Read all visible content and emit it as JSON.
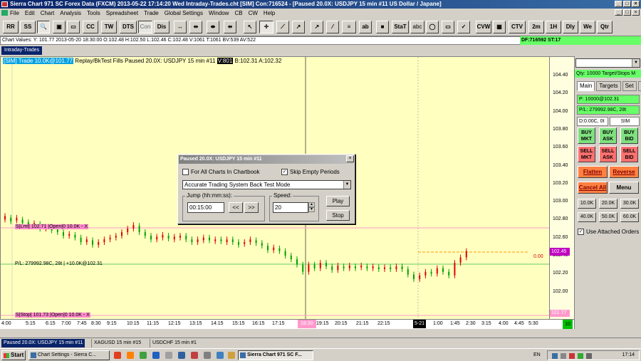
{
  "window": {
    "title": "Sierra Chart 971 SC Forex Data (FXCM) 2013-05-22  17:14:20 Wed  Intraday-Trades.cht [SIM] Con:716524 - [Paused 20.0X: USDJPY  15 min  #11  US Dollar / Japane]"
  },
  "menu": [
    "File",
    "Edit",
    "Chart",
    "Analysis",
    "Tools",
    "Spreadsheet",
    "Trade",
    "Global Settings",
    "Window",
    "CB",
    "CW",
    "Help"
  ],
  "toolbar": {
    "buttons": [
      "RR",
      "SS",
      "CC",
      "TW",
      "DTS",
      "Con",
      "Dis",
      "StaT",
      "abc",
      "CVW",
      "CTV",
      "2m",
      "1H",
      "Dly",
      "We",
      "Qtr"
    ]
  },
  "chart_values": "Chart Values: Y: 101.77  2013-05-20  18:30:00  O:102.48  H:102.50  L:102.46  C:102.48  V:1061  T:1061  BV:539  AV:522",
  "df_status": "DF:716592  ST:17",
  "chartbook_tab": "Intraday-Trades",
  "chart": {
    "header_sim": "[SIM]  Trade  10.0K@101.77",
    "header_mid": " Replay/BkTest Fills  Paused 20.0X: USDJPY  15 min  #11 ",
    "header_v": "V:801",
    "header_tail": " B:102.31  A:102.32",
    "stop_limit_tag": "S|Lmt| 102.71 |Open|0  10.0K - X",
    "pl_tag": "P/L: 279992.98C, 28t | +10.0K@102.31",
    "stop_tag": "S|Stop| 101.73 |Open|0  10.0K - X",
    "zero_label": "0.00",
    "last_price": "102.45",
    "stop_price": "101.77",
    "y_labels": [
      "104.40",
      "104.20",
      "104.00",
      "103.80",
      "103.60",
      "103.40",
      "103.20",
      "103.00",
      "102.80",
      "102.60",
      "102.40",
      "102.20",
      "102.00"
    ],
    "x_labels": [
      "4:00",
      "5:15",
      "6:15",
      "7:00",
      "7:45",
      "8:30",
      "9:15",
      "10:15",
      "11:15",
      "12:15",
      "13:15",
      "14:15",
      "15:15",
      "16:15",
      "17:15",
      "18:30",
      "19:15",
      "20:15",
      "21:15",
      "22:15",
      "5-21",
      "1:00",
      "1:45",
      "2:30",
      "3:15",
      "4:00",
      "4:45",
      "5:30"
    ],
    "x_highlight": "18:30",
    "x_date": "5-21",
    "corner_value": "10"
  },
  "dialog": {
    "title": "Paused 20.0X: USDJPY  15 min  #11",
    "all_charts_label": "For All Charts In Chartbook",
    "skip_empty_label": "Skip Empty Periods",
    "mode_value": "Accurate Trading System Back Test Mode",
    "jump_label": "Jump (hh:mm:ss):",
    "jump_value": "00:15:00",
    "back_label": "<<",
    "fwd_label": ">>",
    "speed_label": "Speed:",
    "speed_value": "20",
    "play_label": "Play",
    "stop_label": "Stop"
  },
  "trade_panel": {
    "qty_target": "Qty: 10000 Target/Stops M",
    "tabs": [
      "Main",
      "Targets",
      "Set",
      "C"
    ],
    "position": "P: 10000@102.31",
    "pl": "P/L: 279992.98C, 28t",
    "daily": "D:0.00C, 0t",
    "sim": "SIM",
    "buy_mkt": "BUY MKT",
    "buy_ask": "BUY ASK",
    "buy_bid": "BUY BID",
    "sell_mkt": "SELL MKT",
    "sell_ask": "SELL ASK",
    "sell_bid": "SELL BID",
    "flatten": "Flatten",
    "reverse": "Reverse",
    "cancel_all": "Cancel All",
    "menu": "Menu",
    "qty_buttons": [
      "10.0K",
      "20.0K",
      "30.0K",
      "40.0K",
      "50.0K",
      "60.0K"
    ],
    "attached_orders": "Use Attached Orders"
  },
  "bottom_tabs": [
    "Paused 20.0X: USDJPY  15 min  #11",
    "XAGUSD  15 min  #15",
    "USDCHF  15 min  #1"
  ],
  "taskbar": {
    "start": "Start",
    "tasks": [
      "Chart Settings - Sierra C...",
      "Sierra Chart 971 SC F..."
    ],
    "lang": "EN",
    "clock": "17:14"
  },
  "colors": {
    "chart_bg": "#ffffc0",
    "up_bar": "#00a000",
    "down_bar": "#e00000",
    "sim_badge": "#00a0e0",
    "green_panel": "#66ff66"
  }
}
